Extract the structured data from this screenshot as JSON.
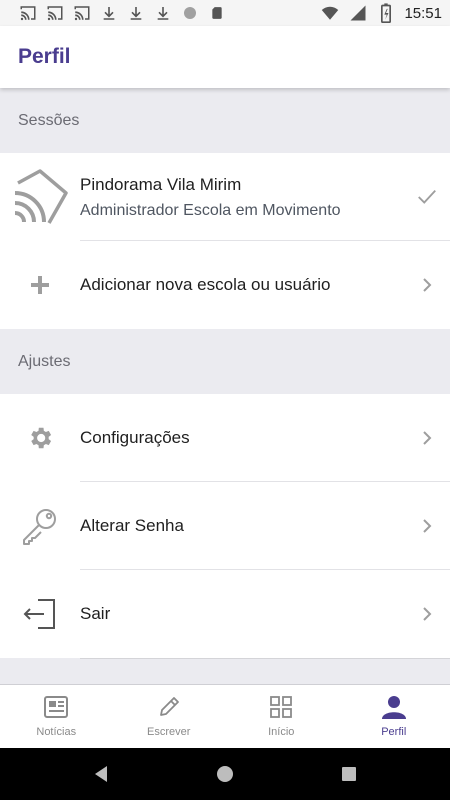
{
  "status_bar": {
    "time": "15:51",
    "left_icons": [
      "cast-icon",
      "cast-icon",
      "cast-icon",
      "download-icon",
      "download-icon",
      "download-icon",
      "circle-icon",
      "sd-card-icon"
    ],
    "right_icons": [
      "wifi-icon",
      "signal-icon",
      "battery-icon"
    ]
  },
  "app_bar": {
    "title": "Perfil"
  },
  "sections": {
    "sessions": {
      "header": "Sessões",
      "session": {
        "title": "Pindorama Vila Mirim",
        "subtitle": "Administrador Escola em Movimento",
        "icon": "cast-icon",
        "trailing": "check-icon"
      },
      "add": {
        "label": "Adicionar nova escola ou usuário",
        "icon": "plus-icon",
        "trailing": "chevron-right-icon"
      }
    },
    "settings": {
      "header": "Ajustes",
      "items": [
        {
          "label": "Configurações",
          "icon": "gear-icon"
        },
        {
          "label": "Alterar Senha",
          "icon": "key-icon"
        },
        {
          "label": "Sair",
          "icon": "logout-icon"
        }
      ]
    }
  },
  "tab_bar": {
    "tabs": [
      {
        "label": "Notícias",
        "icon": "newspaper-icon",
        "active": false
      },
      {
        "label": "Escrever",
        "icon": "pencil-icon",
        "active": false
      },
      {
        "label": "Início",
        "icon": "grid-icon",
        "active": false
      },
      {
        "label": "Perfil",
        "icon": "person-icon",
        "active": true
      }
    ]
  },
  "nav_bar": {
    "buttons": [
      "back-icon",
      "home-icon",
      "recents-icon"
    ]
  },
  "colors": {
    "accent": "#4a3d8f",
    "section_background": "#ebebf0",
    "icon_gray": "#9e9e9e",
    "text_primary": "#1f1f1f",
    "text_secondary": "#4f5661"
  }
}
